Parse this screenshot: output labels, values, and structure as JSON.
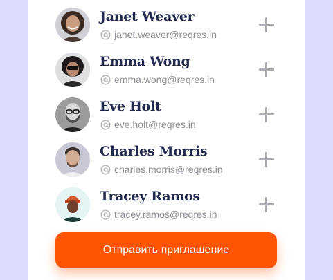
{
  "users": [
    {
      "name": "Janet Weaver",
      "email": "janet.weaver@reqres.in"
    },
    {
      "name": "Emma Wong",
      "email": "emma.wong@reqres.in"
    },
    {
      "name": "Eve Holt",
      "email": "eve.holt@reqres.in"
    },
    {
      "name": "Charles Morris",
      "email": "charles.morris@reqres.in"
    },
    {
      "name": "Tracey Ramos",
      "email": "tracey.ramos@reqres.in"
    }
  ],
  "invite_button": {
    "label": "Отправить приглашение"
  },
  "icons": {
    "email": "at-icon",
    "add": "plus-icon"
  },
  "colors": {
    "background": "#dcdcff",
    "panel": "#ffffff",
    "name_text": "#222a4f",
    "email_text": "#8f8f98",
    "add_icon": "#a9a9af",
    "accent": "#ff5500"
  }
}
